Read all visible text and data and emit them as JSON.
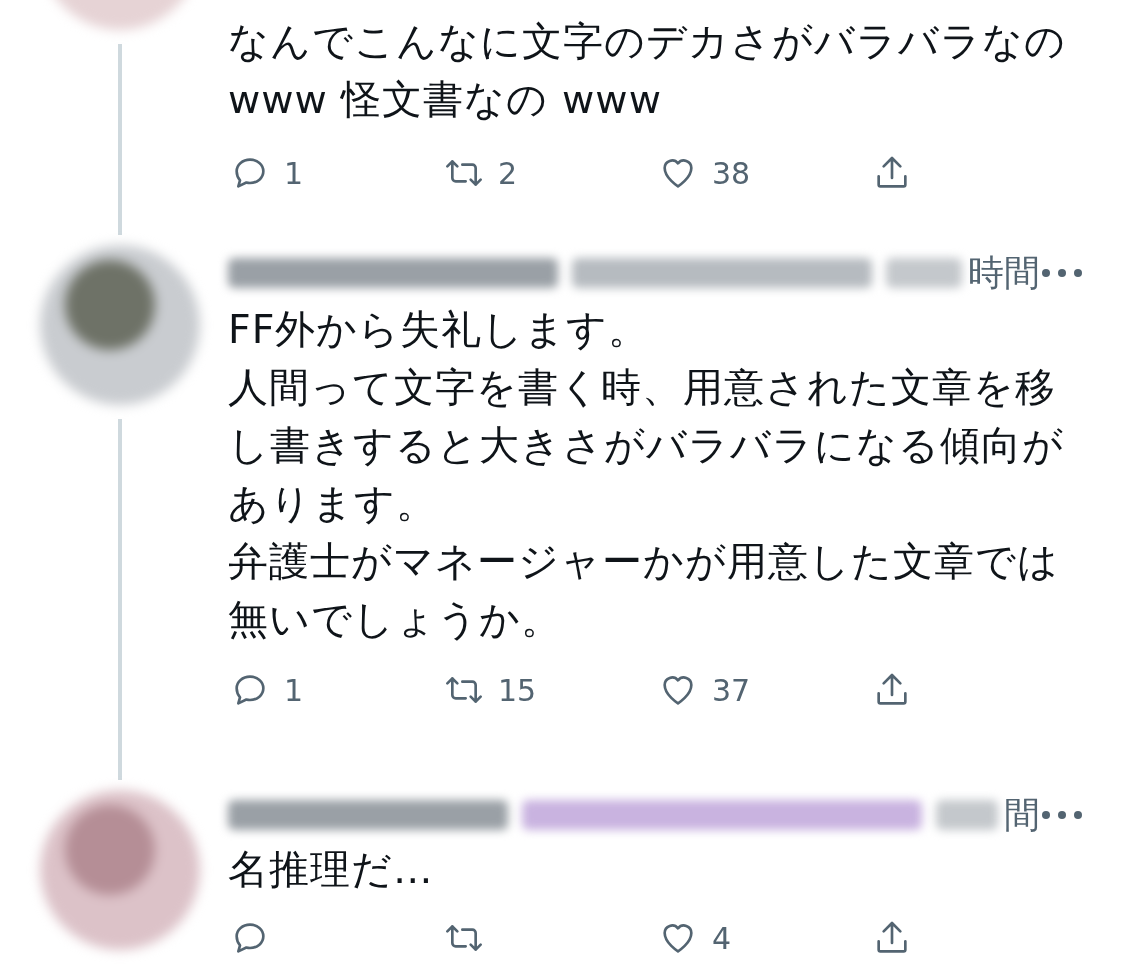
{
  "tweets": [
    {
      "lines": [
        "なんでこんなに文字のデカさがバラバラなの",
        "www 怪文書なの www"
      ],
      "actions": {
        "replies": "1",
        "retweets": "2",
        "likes": "38"
      },
      "thread_below": true
    },
    {
      "header": {
        "time": "時間"
      },
      "lines": [
        "FF外から失礼します。",
        "人間って文字を書く時、用意された文章を移",
        "し書きすると大きさがバラバラになる傾向が",
        "あります。",
        "弁護士がマネージャーかが用意した文章では",
        "無いでしょうか。"
      ],
      "actions": {
        "replies": "1",
        "retweets": "15",
        "likes": "37"
      },
      "thread_below": true
    },
    {
      "header": {
        "time": "間"
      },
      "lines": [
        "名推理だ…"
      ],
      "actions": {
        "likes": "4"
      },
      "thread_below": false
    }
  ]
}
